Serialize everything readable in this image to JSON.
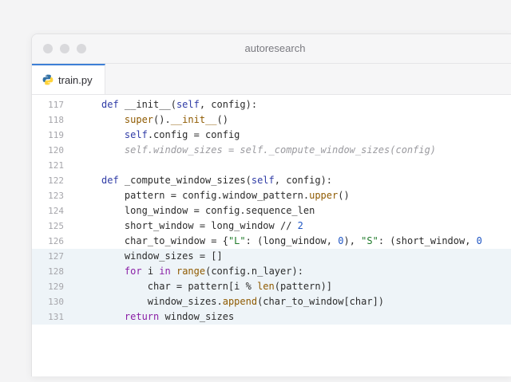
{
  "window": {
    "title": "autoresearch",
    "tab": {
      "label": "train.py",
      "icon": "python-file-icon"
    }
  },
  "code": {
    "lines": [
      {
        "num": "117",
        "indent": "",
        "tokens": [
          [
            "kw",
            "def"
          ],
          [
            "fn",
            " __init__("
          ],
          [
            "self",
            "self"
          ],
          [
            "fn",
            ", config):"
          ]
        ]
      },
      {
        "num": "118",
        "indent": "    ",
        "tokens": [
          [
            "bi",
            "super"
          ],
          [
            "fn",
            "()."
          ],
          [
            "bi",
            "__init__"
          ],
          [
            "fn",
            "()"
          ]
        ]
      },
      {
        "num": "119",
        "indent": "    ",
        "tokens": [
          [
            "self",
            "self"
          ],
          [
            "fn",
            ".config = config"
          ]
        ]
      },
      {
        "num": "120",
        "indent": "    ",
        "tokens": [
          [
            "comment",
            "self.window_sizes = self._compute_window_sizes(config)"
          ]
        ]
      },
      {
        "num": "121",
        "indent": "",
        "tokens": []
      },
      {
        "num": "122",
        "indent": "",
        "tokens": [
          [
            "kw",
            "def"
          ],
          [
            "fn",
            " _compute_window_sizes("
          ],
          [
            "self",
            "self"
          ],
          [
            "fn",
            ", config):"
          ]
        ]
      },
      {
        "num": "123",
        "indent": "    ",
        "tokens": [
          [
            "fn",
            "pattern = config.window_pattern."
          ],
          [
            "bi",
            "upper"
          ],
          [
            "fn",
            "()"
          ]
        ]
      },
      {
        "num": "124",
        "indent": "    ",
        "tokens": [
          [
            "fn",
            "long_window = config.sequence_len"
          ]
        ]
      },
      {
        "num": "125",
        "indent": "    ",
        "tokens": [
          [
            "fn",
            "short_window = long_window // "
          ],
          [
            "num",
            "2"
          ]
        ]
      },
      {
        "num": "126",
        "indent": "    ",
        "tokens": [
          [
            "fn",
            "char_to_window = {"
          ],
          [
            "str",
            "\"L\""
          ],
          [
            "fn",
            ": (long_window, "
          ],
          [
            "num",
            "0"
          ],
          [
            "fn",
            "), "
          ],
          [
            "str",
            "\"S\""
          ],
          [
            "fn",
            ": (short_window, "
          ],
          [
            "num",
            "0"
          ]
        ]
      },
      {
        "num": "127",
        "indent": "    ",
        "hl": true,
        "tokens": [
          [
            "fn",
            "window_sizes = []"
          ]
        ]
      },
      {
        "num": "128",
        "indent": "    ",
        "hl": true,
        "tokens": [
          [
            "kw2",
            "for"
          ],
          [
            "fn",
            " i "
          ],
          [
            "kw2",
            "in"
          ],
          [
            "fn",
            " "
          ],
          [
            "bi",
            "range"
          ],
          [
            "fn",
            "(config.n_layer):"
          ]
        ]
      },
      {
        "num": "129",
        "indent": "        ",
        "hl": true,
        "tokens": [
          [
            "fn",
            "char = pattern[i % "
          ],
          [
            "bi",
            "len"
          ],
          [
            "fn",
            "(pattern)]"
          ]
        ]
      },
      {
        "num": "130",
        "indent": "        ",
        "hl": true,
        "tokens": [
          [
            "fn",
            "window_sizes."
          ],
          [
            "bi",
            "append"
          ],
          [
            "fn",
            "(char_to_window[char])"
          ]
        ]
      },
      {
        "num": "131",
        "indent": "    ",
        "hl": true,
        "tokens": [
          [
            "kw2",
            "return"
          ],
          [
            "fn",
            " window_sizes"
          ]
        ]
      }
    ]
  },
  "colors": {
    "tab_accent": "#3d7fd6",
    "highlight": "#eef4f8"
  }
}
